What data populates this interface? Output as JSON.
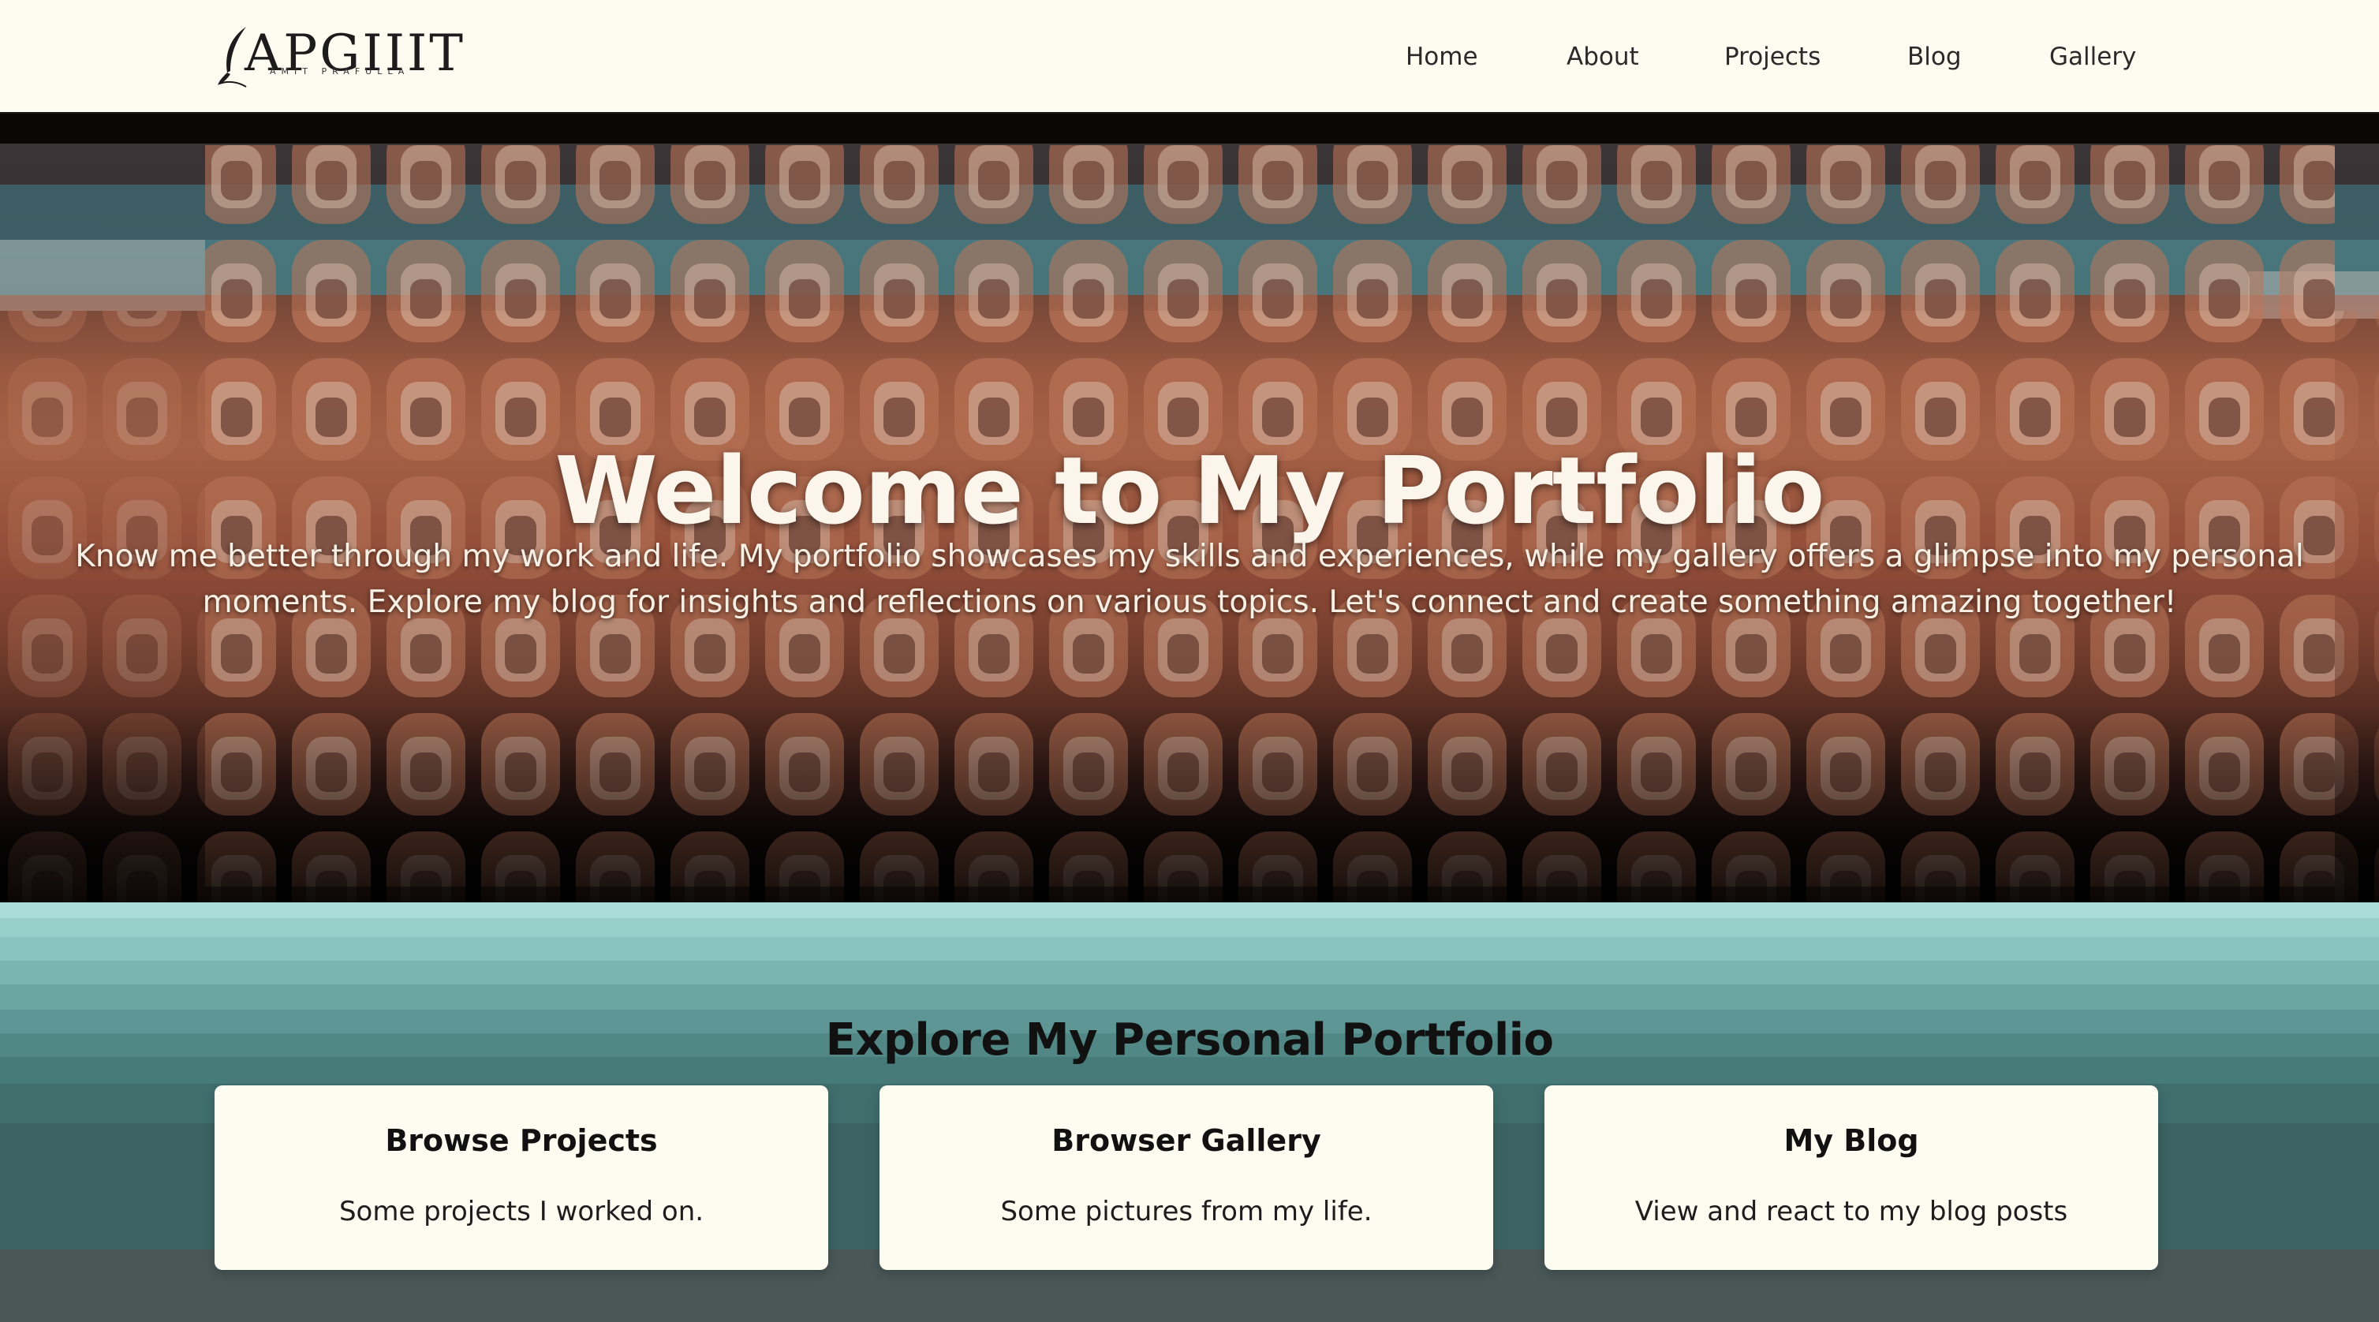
{
  "header": {
    "logo_text": "APGIIIT",
    "logo_subtext": "AMIT PRAFULLA",
    "nav": [
      {
        "label": "Home"
      },
      {
        "label": "About"
      },
      {
        "label": "Projects"
      },
      {
        "label": "Blog"
      },
      {
        "label": "Gallery"
      }
    ]
  },
  "hero": {
    "title": "Welcome to My Portfolio",
    "text": "Know me better through my work and life. My portfolio showcases my skills and experiences, while my gallery offers a glimpse into my personal moments. Explore my blog for insights and reflections on various topics. Let's connect and create something amazing together!"
  },
  "explore": {
    "title": "Explore My Personal Portfolio",
    "cards": [
      {
        "title": "Browse Projects",
        "description": "Some projects I worked on."
      },
      {
        "title": "Browser Gallery",
        "description": "Some pictures from my life."
      },
      {
        "title": "My Blog",
        "description": "View and react to my blog posts"
      }
    ]
  },
  "colors": {
    "page_background": "#fdfcf1",
    "header_text": "#2a2a2a",
    "hero_text": "#fbf5ec",
    "teal_band_top": "#a9dcd8",
    "teal_band_bottom": "#3a6362",
    "card_background": "#fdfcf1"
  }
}
